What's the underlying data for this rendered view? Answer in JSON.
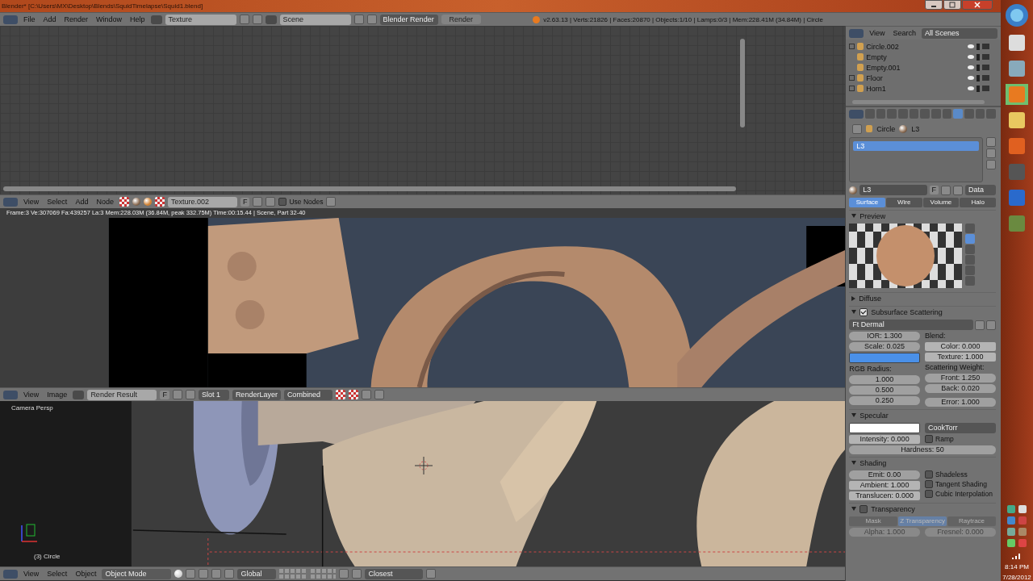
{
  "title_bar": {
    "title": "Blender* [C:\\Users\\MX\\Desktop\\Blends\\SquidTimelapse\\Squid1.blend]"
  },
  "info_header": {
    "menus": [
      "File",
      "Add",
      "Render",
      "Window",
      "Help"
    ],
    "layout": "Texture",
    "scene": "Scene",
    "engine": "Blender Render",
    "render_button": "Render",
    "stats": "v2.63.13 | Verts:21826 | Faces:20870 | Objects:1/10 | Lamps:0/3 | Mem:228.41M (34.84M) | Circle"
  },
  "node_header": {
    "menus": [
      "View",
      "Select",
      "Add",
      "Node"
    ],
    "texture": "Texture.002",
    "fake_user": "F",
    "use_nodes": {
      "label": "Use Nodes",
      "checked": false
    }
  },
  "render_view": {
    "info": "Frame:3 Ve:307069 Fa:439257 La:3 Mem:228.03M (36.84M, peak 332.75M) Time:00:15.44 | Scene, Part 32-40"
  },
  "image_header": {
    "menus": [
      "View",
      "Image"
    ],
    "image": "Render Result",
    "fake_user": "F",
    "slot": "Slot 1",
    "layer": "RenderLayer",
    "pass": "Combined"
  },
  "viewport": {
    "view_name": "Camera Persp",
    "object_name": "(3) Circle"
  },
  "view3d_header": {
    "menus": [
      "View",
      "Select",
      "Object"
    ],
    "mode": "Object Mode",
    "orientation": "Global",
    "snap": "Closest"
  },
  "outliner": {
    "menus": [
      "View",
      "Search"
    ],
    "display": "All Scenes",
    "rows": [
      {
        "name": "Circle.002",
        "expandable": true
      },
      {
        "name": "Empty",
        "expandable": false
      },
      {
        "name": "Empty.001",
        "expandable": false
      },
      {
        "name": "Floor",
        "expandable": true
      },
      {
        "name": "Horn1",
        "expandable": true
      }
    ]
  },
  "properties": {
    "breadcrumb": [
      "Circle",
      "L3"
    ],
    "slots": [
      {
        "name": "L3",
        "selected": true
      }
    ],
    "material": "L3",
    "fake_user": "F",
    "link": "Data",
    "tabs": [
      {
        "label": "Surface",
        "selected": true
      },
      {
        "label": "Wire",
        "selected": false
      },
      {
        "label": "Volume",
        "selected": false
      },
      {
        "label": "Halo",
        "selected": false
      }
    ],
    "preview": {
      "title": "Preview",
      "expanded": true
    },
    "diffuse": {
      "title": "Diffuse",
      "expanded": false
    },
    "sss": {
      "title": "Subsurface Scattering",
      "expanded": true,
      "checked": true,
      "preset": "Ft Dermal",
      "ior": "IOR: 1.300",
      "scale": "Scale: 0.025",
      "color": "#4a90e8",
      "radius_label": "RGB Radius:",
      "radius": [
        "1.000",
        "0.500",
        "0.250"
      ],
      "blend_label": "Blend:",
      "blend": [
        "Color: 0.000",
        "Texture: 1.000"
      ],
      "weight_label": "Scattering Weight:",
      "weight": [
        "Front: 1.250",
        "Back: 0.020"
      ],
      "error": "Error: 1.000"
    },
    "specular": {
      "title": "Specular",
      "expanded": true,
      "color": "#ffffff",
      "shader": "CookTorr",
      "ramp": {
        "label": "Ramp",
        "checked": false
      },
      "intensity": "Intensity: 0.000",
      "hardness": "Hardness: 50"
    },
    "shading": {
      "title": "Shading",
      "expanded": true,
      "fields": [
        "Emit: 0.00",
        "Ambient: 1.000",
        "Translucen: 0.000"
      ],
      "options": [
        {
          "label": "Shadeless",
          "checked": false
        },
        {
          "label": "Tangent Shading",
          "checked": false
        },
        {
          "label": "Cubic Interpolation",
          "checked": false
        }
      ]
    },
    "transparency": {
      "title": "Transparency",
      "expanded": true,
      "checked": false,
      "modes": [
        {
          "label": "Mask",
          "selected": false
        },
        {
          "label": "Z Transparency",
          "selected": true
        },
        {
          "label": "Raytrace",
          "selected": false
        }
      ],
      "fields": [
        "Alpha: 1.000",
        "Fresnel: 0.000"
      ]
    }
  },
  "taskbar": {
    "time": "8:14 PM",
    "date": "7/28/2012"
  }
}
